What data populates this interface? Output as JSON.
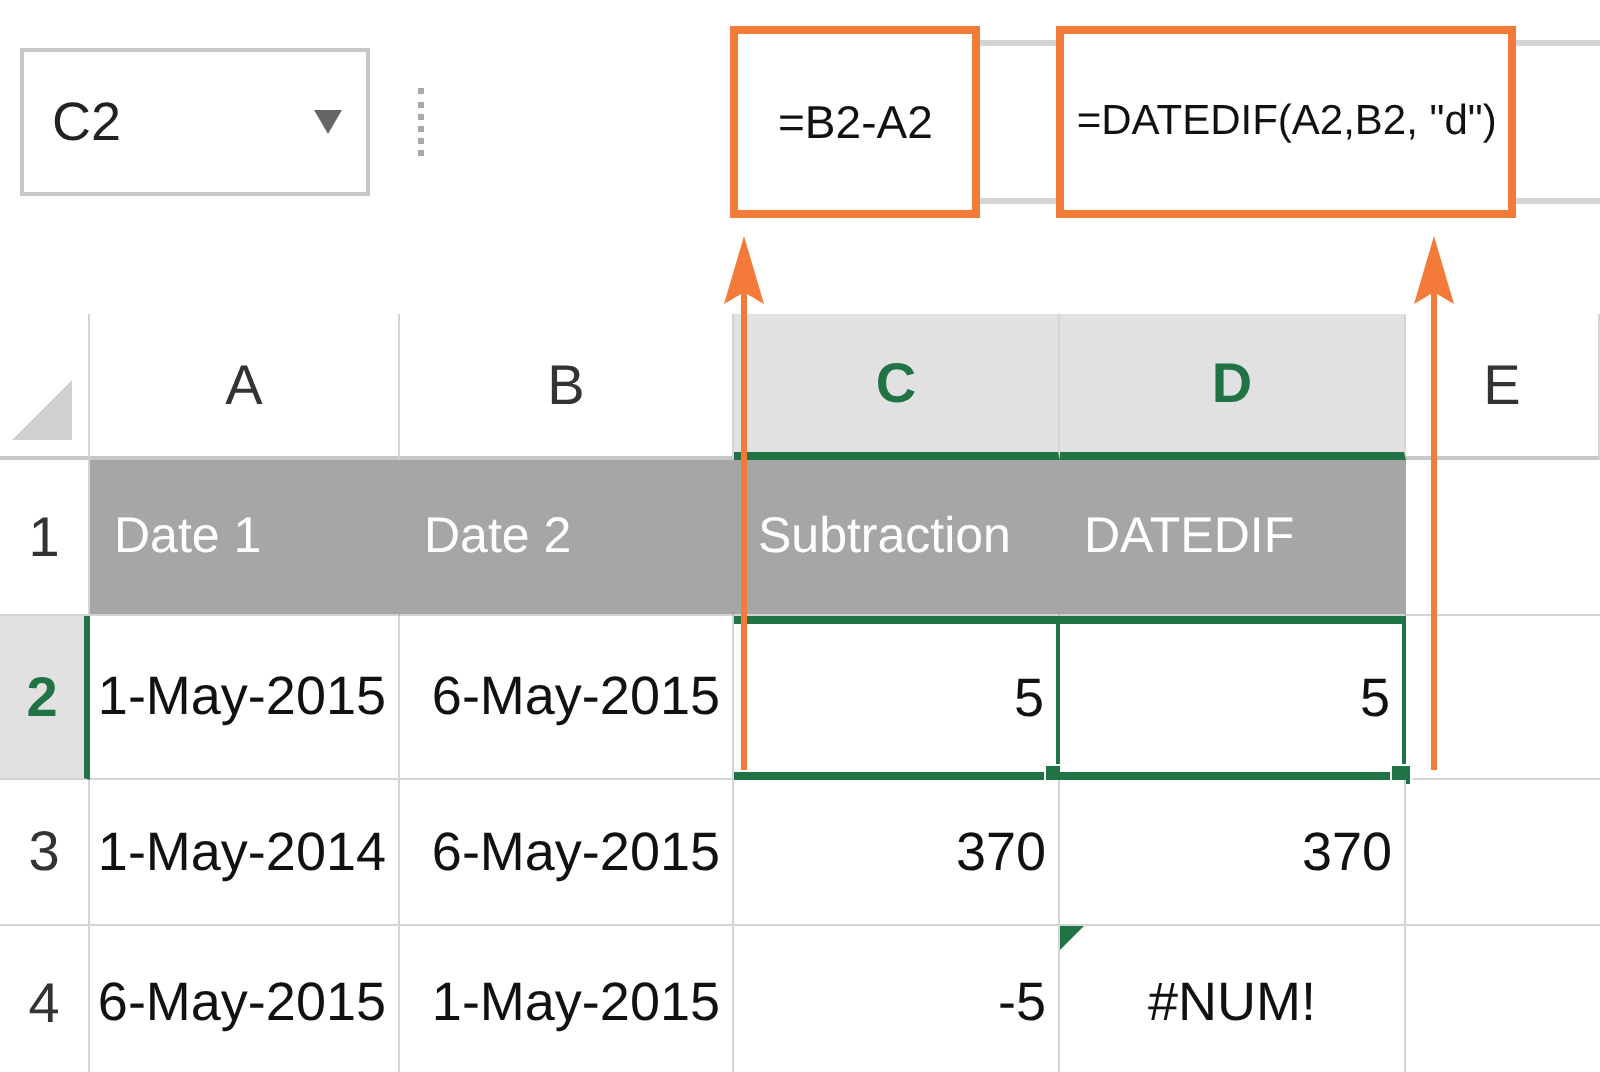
{
  "name_box": {
    "value": "C2"
  },
  "formula_callouts": [
    "=B2-A2",
    "=DATEDIF(A2,B2, \"d\")"
  ],
  "columns": [
    {
      "label": "A",
      "selected": false
    },
    {
      "label": "B",
      "selected": false
    },
    {
      "label": "C",
      "selected": true
    },
    {
      "label": "D",
      "selected": true
    },
    {
      "label": "E",
      "selected": false
    }
  ],
  "rows": [
    {
      "number": "1",
      "selected": false,
      "kind": "header",
      "cells": [
        {
          "text": "Date 1",
          "selected": false
        },
        {
          "text": "Date 2",
          "selected": false
        },
        {
          "text": "Subtraction",
          "selected": false
        },
        {
          "text": "DATEDIF",
          "selected": false
        }
      ]
    },
    {
      "number": "2",
      "selected": true,
      "kind": "data",
      "cells": [
        {
          "text": "1-May-2015",
          "selected": false,
          "kind": "value"
        },
        {
          "text": "6-May-2015",
          "selected": false,
          "kind": "value"
        },
        {
          "text": "5",
          "selected": true,
          "kind": "value"
        },
        {
          "text": "5",
          "selected": true,
          "kind": "value"
        }
      ]
    },
    {
      "number": "3",
      "selected": false,
      "kind": "data",
      "cells": [
        {
          "text": "1-May-2014",
          "selected": false,
          "kind": "value"
        },
        {
          "text": "6-May-2015",
          "selected": false,
          "kind": "value"
        },
        {
          "text": "370",
          "selected": false,
          "kind": "value"
        },
        {
          "text": "370",
          "selected": false,
          "kind": "value"
        }
      ]
    },
    {
      "number": "4",
      "selected": false,
      "kind": "data",
      "cells": [
        {
          "text": "6-May-2015",
          "selected": false,
          "kind": "value"
        },
        {
          "text": "1-May-2015",
          "selected": false,
          "kind": "value"
        },
        {
          "text": "-5",
          "selected": false,
          "kind": "value"
        },
        {
          "text": "#NUM!",
          "selected": false,
          "kind": "error",
          "error_flag": true
        }
      ]
    }
  ]
}
